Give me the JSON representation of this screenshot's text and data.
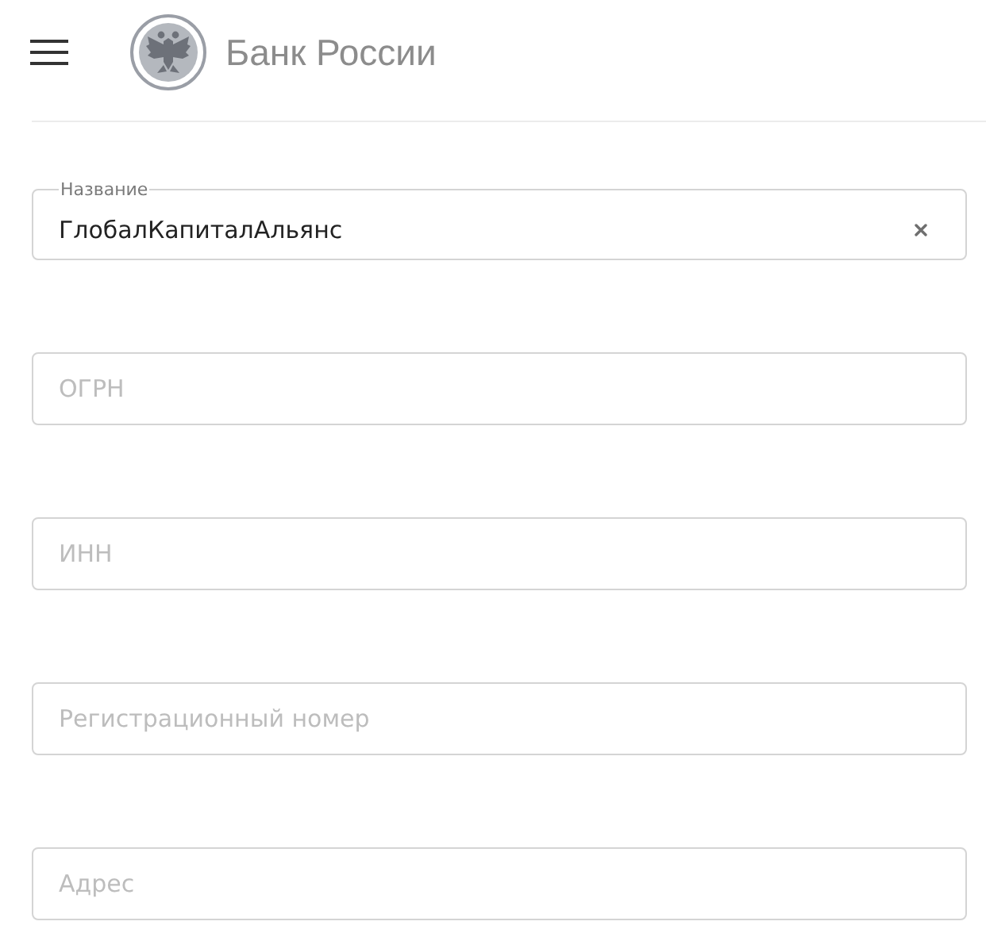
{
  "header": {
    "brand": "Банк России"
  },
  "fields": [
    {
      "label": "Название",
      "value": "ГлобалКапиталАльянс",
      "clearable": true
    },
    {
      "placeholder": "ОГРН",
      "clearable": false
    },
    {
      "placeholder": "ИНН",
      "clearable": false
    },
    {
      "placeholder": "Регистрационный номер",
      "clearable": false
    },
    {
      "placeholder": "Адрес",
      "clearable": false
    }
  ]
}
